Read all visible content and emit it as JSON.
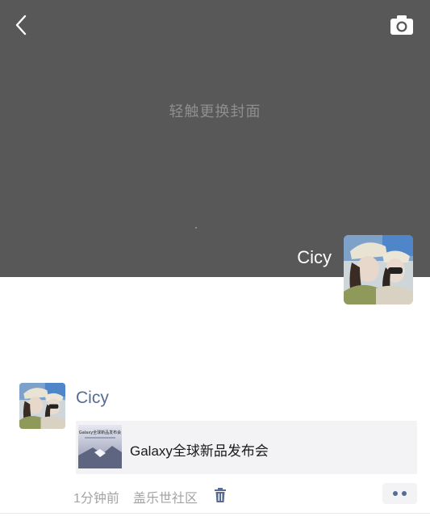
{
  "cover": {
    "hint": "轻触更换封面",
    "back_icon": "chevron-left-icon",
    "camera_icon": "camera-icon",
    "background_color": "#585858"
  },
  "profile": {
    "name": "Cicy",
    "avatar_icon": "user-avatar-photo"
  },
  "post": {
    "author": "Cicy",
    "author_color": "#576b95",
    "link_card": {
      "title": "Galaxy全球新品发布会",
      "thumbnail_text": "Galaxy全球新品发布会"
    },
    "time": "1分钟前",
    "location": "盖乐世社区",
    "delete_icon": "trash-icon",
    "more_icon": "more-dots-icon"
  }
}
